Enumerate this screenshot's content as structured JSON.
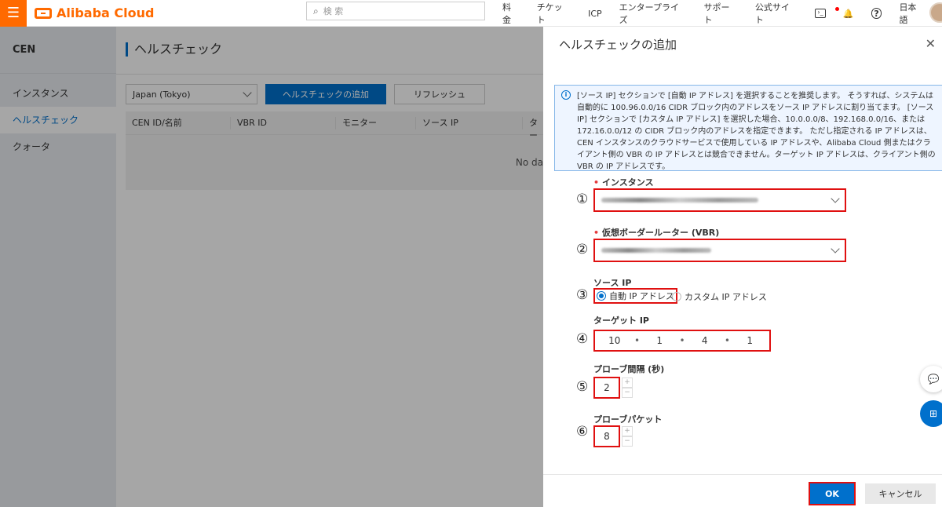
{
  "topbar": {
    "logo_text": "Alibaba Cloud",
    "search_placeholder": "検 索",
    "nav": [
      "料金",
      "チケット",
      "ICP",
      "エンタープライズ",
      "サポート",
      "公式サイト"
    ],
    "language": "日本語"
  },
  "sidebar": {
    "product": "CEN",
    "items": [
      {
        "label": "インスタンス",
        "active": false
      },
      {
        "label": "ヘルスチェック",
        "active": true
      },
      {
        "label": "クォータ",
        "active": false
      }
    ]
  },
  "main": {
    "title": "ヘルスチェック",
    "region": "Japan (Tokyo)",
    "add_button": "ヘルスチェックの追加",
    "refresh_button": "リフレッシュ",
    "columns": [
      "CEN ID/名前",
      "VBR ID",
      "モニター",
      "ソース IP",
      "ター"
    ],
    "no_data": "No da"
  },
  "drawer": {
    "title": "ヘルスチェックの追加",
    "info_text": "[ソース IP] セクションで [自動 IP アドレス] を選択することを推奨します。 そうすれば、システムは自動的に 100.96.0.0/16 CIDR ブロック内のアドレスをソース IP アドレスに割り当てます。 [ソース IP] セクションで [カスタム IP アドレス] を選択した場合、10.0.0.0/8、192.168.0.0/16、または 172.16.0.0/12 の CIDR ブロック内のアドレスを指定できます。 ただし指定される IP アドレスは、CEN インスタンスのクラウドサービスで使用している IP アドレスや、Alibaba Cloud 側またはクライアント側の VBR の IP アドレスとは競合できません。ターゲット IP アドレスは、クライアント側の VBR の IP アドレスです。",
    "instance_label": "インスタンス",
    "vbr_label": "仮想ボーダールーター (VBR)",
    "source_ip_label": "ソース IP",
    "source_auto": "自動 IP アドレス",
    "source_custom": "カスタム IP アドレス",
    "target_ip_label": "ターゲット IP",
    "target_ip": [
      "10",
      "1",
      "4",
      "1"
    ],
    "probe_interval_label": "プローブ間隔 (秒)",
    "probe_interval": "2",
    "probe_packets_label": "プローブパケット",
    "probe_packets": "8",
    "ok_button": "OK",
    "cancel_button": "キャンセル",
    "step_markers": [
      "①",
      "②",
      "③",
      "④",
      "⑤",
      "⑥"
    ]
  },
  "colors": {
    "accent": "#0070cc",
    "brand": "#ff6a00",
    "highlight": "#e01010"
  }
}
